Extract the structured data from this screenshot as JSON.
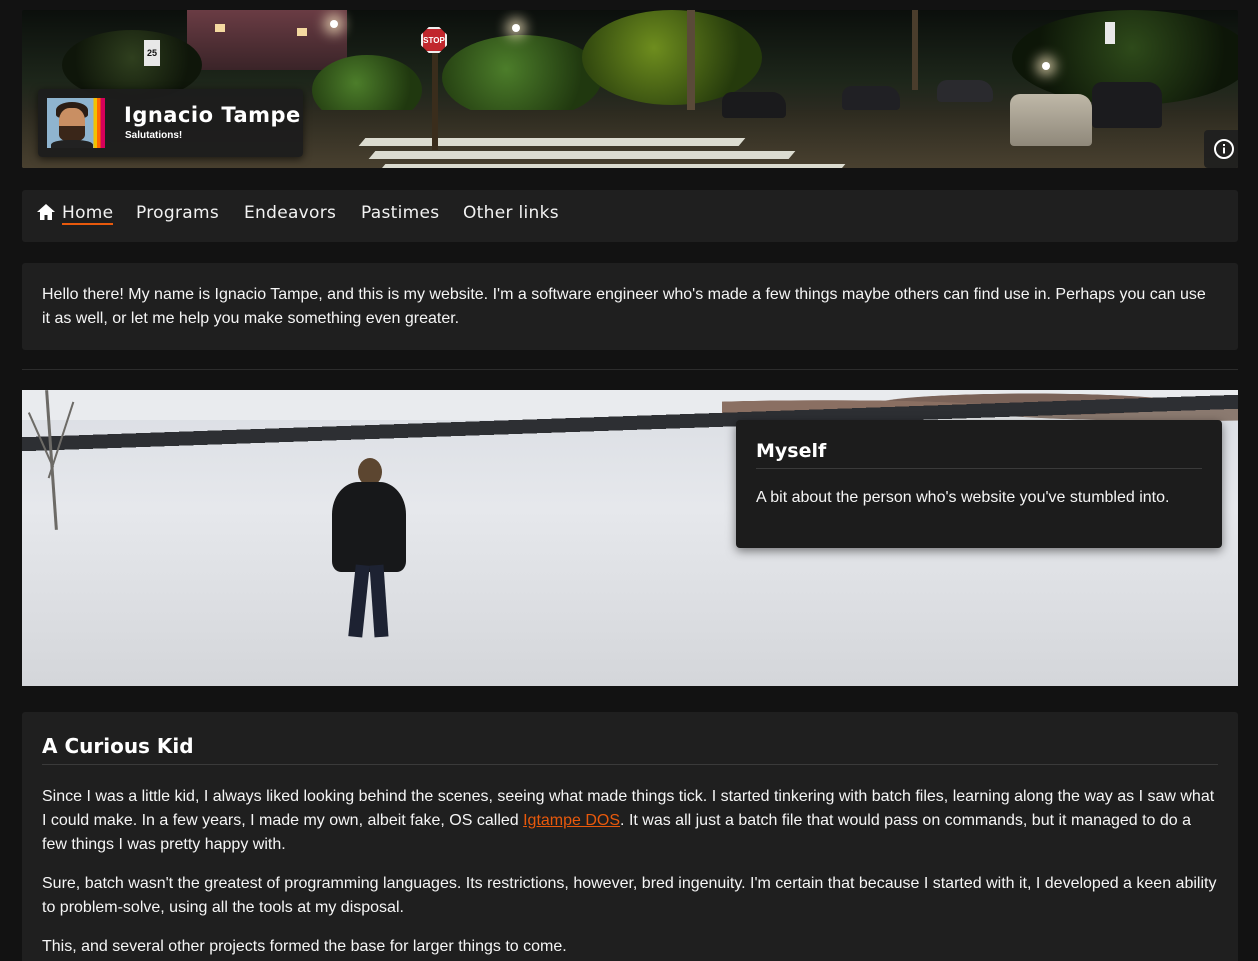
{
  "header": {
    "name": "Ignacio Tampe",
    "tagline": "Salutations!",
    "stop_sign_text": "STOP",
    "speed_sign_text": "25",
    "info_icon": "info-icon"
  },
  "nav": {
    "items": [
      {
        "label": "Home",
        "icon": "home-icon",
        "active": true
      },
      {
        "label": "Programs"
      },
      {
        "label": "Endeavors"
      },
      {
        "label": "Pastimes"
      },
      {
        "label": "Other links"
      }
    ]
  },
  "intro": {
    "text": "Hello there! My name is Ignacio Tampe, and this is my website. I'm a software engineer who's made a few things maybe others can find use in. Perhaps you can use it as well, or let me help you make something even greater."
  },
  "hero": {
    "title": "Myself",
    "description": "A bit about the person who's website you've stumbled into."
  },
  "article": {
    "title": "A Curious Kid",
    "p1_before": "Since I was a little kid, I always liked looking behind the scenes, seeing what made things tick. I started tinkering with batch files, learning along the way as I saw what I could make. In a few years, I made my own, albeit fake, OS called ",
    "p1_link": "Igtampe DOS",
    "p1_after": ". It was all just a batch file that would pass on commands, but it managed to do a few things I was pretty happy with.",
    "p2": "Sure, batch wasn't the greatest of programming languages. Its restrictions, however, bred ingenuity. I'm certain that because I started with it, I developed a keen ability to problem-solve, using all the tools at my disposal.",
    "p3": "This, and several other projects formed the base for larger things to come."
  },
  "colors": {
    "accent": "#e8590c",
    "background": "#121212",
    "card": "#1f1f1f"
  }
}
